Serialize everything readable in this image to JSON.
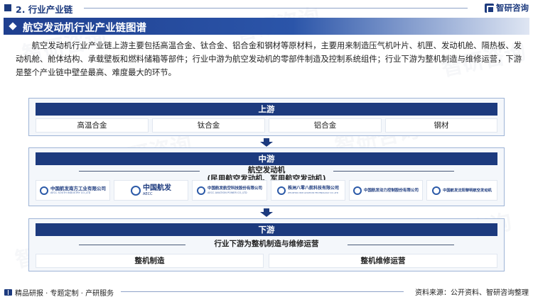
{
  "header": {
    "section": "2. 行业产业链",
    "brand": "智研咨询"
  },
  "title": "航空发动机行业产业链图谱",
  "intro": "航空发动机行业产业链上游主要包括高温合金、钛合金、铝合金和钢材等原材料，主要用来制造压气机叶片、机匣、发动机舱、隔热板、发动机舱、舱体结构、承载壁板和燃料储箱等部件；行业中游为航空发动机的零部件制造及控制系统组件；行业下游为整机制造与维修运营，下游是整个产业链中壁垒最高、难度最大的环节。",
  "upstream": {
    "label": "上游",
    "items": [
      "高温合金",
      "钛合金",
      "铝合金",
      "钢材"
    ]
  },
  "midstream": {
    "label": "中游",
    "subtitle_line1": "航空发动机",
    "subtitle_line2": "(民用航空发动机、军用航空发动机)",
    "companies": [
      {
        "cn": "中国航发南方工业有限公司",
        "en": "AECC SOUTH INDUSTRY CO.,LTD"
      },
      {
        "cn": "中国航发",
        "en": "AECC"
      },
      {
        "cn": "中国航发航空科技股份有限公司",
        "en": "AECC AVIATION POWER CO.,LTD"
      },
      {
        "cn": "株洲八零八航科技有限公司",
        "en": "ZHUZHOU 808 AVIATION TECHNOLOGY CO.,LTD"
      },
      {
        "cn": "中国航发动力控制股份有限公司",
        "en": ""
      },
      {
        "cn": "中国航发沈阳黎明航空发动机",
        "en": ""
      }
    ]
  },
  "downstream": {
    "label": "下游",
    "subtitle": "行业下游为整机制造与维修运营",
    "items": [
      "整机制造",
      "整机维修运营"
    ]
  },
  "footer": {
    "left": "精品研报 · 专题定制 · 产研服务",
    "right": "资料来源：公开资料、智研咨询整理"
  },
  "colors": {
    "primary": "#1c3a7e",
    "panel_bg": "#f4f7fb",
    "panel_border": "#9eb4d6"
  },
  "watermark": "智研咨询"
}
